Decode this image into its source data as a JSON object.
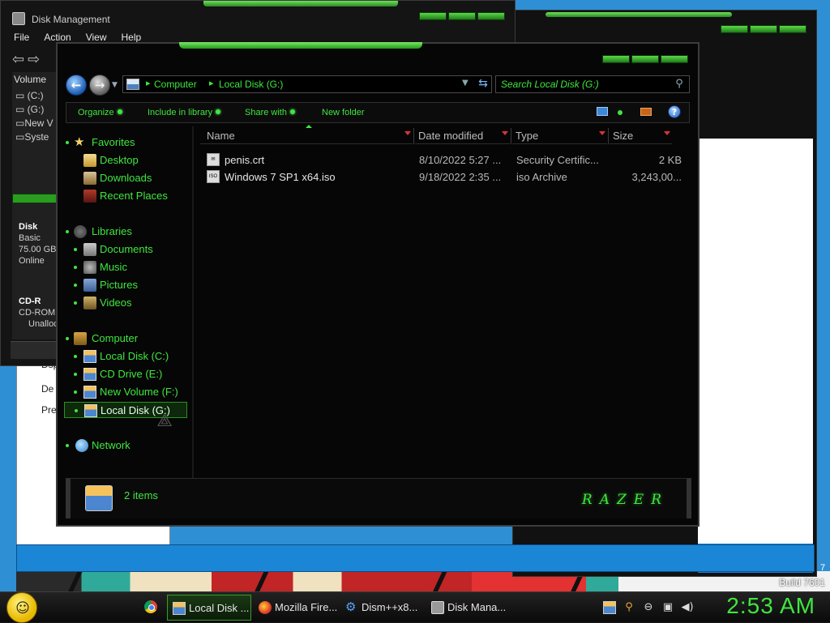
{
  "desktop": {
    "build_text": "Build 7601",
    "page_digit": "7"
  },
  "white_doc": {
    "line1": "Dsp",
    "line2": "De",
    "line3": "Pre"
  },
  "disk_management": {
    "title": "Disk Management",
    "menu": [
      "File",
      "Action",
      "View",
      "Help"
    ],
    "column_header": "Volume",
    "volumes": [
      "(C:)",
      "(G:)",
      "New V",
      "Syste"
    ],
    "disk0": {
      "name": "Disk",
      "type": "Basic",
      "size": "75.00 GB",
      "status": "Online"
    },
    "cdrom": {
      "name": "CD-R",
      "type": "CD-ROM",
      "status": "Unalloc"
    }
  },
  "explorer": {
    "address": {
      "crumbs": [
        "Computer",
        "Local Disk (G:)"
      ]
    },
    "search": {
      "placeholder": "Search Local Disk (G:)"
    },
    "commands": {
      "organize": "Organize",
      "include_in_library": "Include in library",
      "share_with": "Share with",
      "new_folder": "New folder"
    },
    "nav": {
      "favorites": "Favorites",
      "desktop": "Desktop",
      "downloads": "Downloads",
      "recent_places": "Recent Places",
      "libraries": "Libraries",
      "documents": "Documents",
      "music": "Music",
      "pictures": "Pictures",
      "videos": "Videos",
      "computer": "Computer",
      "drive_c": "Local Disk (C:)",
      "drive_e": "CD Drive (E:)",
      "drive_f": "New Volume (F:)",
      "drive_g": "Local Disk (G:)",
      "network": "Network"
    },
    "columns": [
      "Name",
      "Date modified",
      "Type",
      "Size"
    ],
    "files": [
      {
        "name": "penis.crt",
        "date": "8/10/2022 5:27 ...",
        "type": "Security Certific...",
        "size": "2 KB",
        "icon": "certificate-icon"
      },
      {
        "name": "Windows 7 SP1 x64.iso",
        "date": "9/18/2022 2:35 ...",
        "type": "iso Archive",
        "size": "3,243,00...",
        "icon": "iso-icon"
      }
    ],
    "details": {
      "count_text": "2 items",
      "brand": "RAZER"
    }
  },
  "taskbar": {
    "buttons": [
      {
        "label": "Local Disk ...",
        "icon": "folder-icon",
        "active": true
      },
      {
        "label": "Mozilla Fire...",
        "icon": "firefox-icon",
        "active": false
      },
      {
        "label": "Dism++x8...",
        "icon": "gear-icon",
        "active": false
      },
      {
        "label": "Disk Mana...",
        "icon": "disk-icon",
        "active": false
      }
    ],
    "clock": "2:53 AM"
  },
  "colors": {
    "accent_green": "#3fe63f",
    "window_black": "#060606",
    "desktop_blue": "#2f8fd4"
  }
}
